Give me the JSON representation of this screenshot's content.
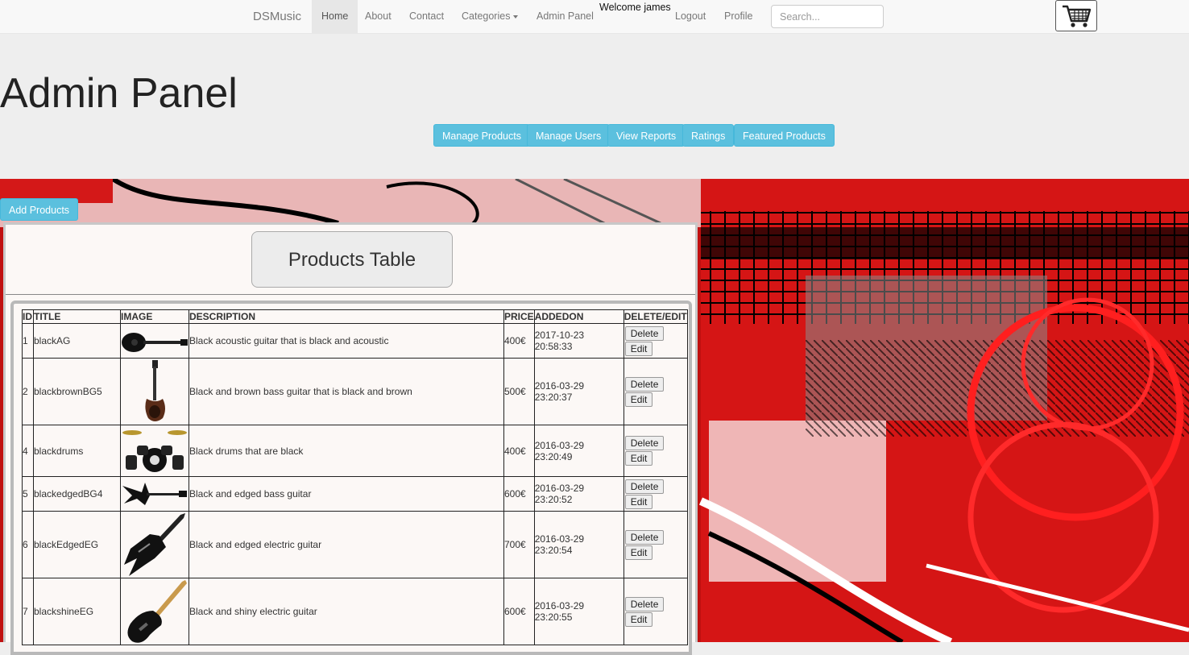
{
  "nav": {
    "brand": "DSMusic",
    "home": "Home",
    "about": "About",
    "contact": "Contact",
    "categories": "Categories",
    "admin_panel": "Admin Panel",
    "welcome": "Welcome james",
    "logout": "Logout",
    "profile": "Profile",
    "search_placeholder": "Search...",
    "cart_icon": "shopping-cart-icon"
  },
  "header": {
    "title": "Admin Panel",
    "buttons": [
      "Manage Products",
      "Manage Users",
      "View Reports",
      "Ratings",
      "Featured Products"
    ]
  },
  "add_button": "Add Products",
  "table": {
    "title": "Products Table",
    "columns": [
      "ID",
      "TITLE",
      "IMAGE",
      "DESCRIPTION",
      "PRICE",
      "ADDEDON",
      "DELETE/EDIT"
    ],
    "delete_label": "Delete",
    "edit_label": "Edit",
    "rows": [
      {
        "id": "1",
        "title": "blackAG",
        "image": "acoustic-guitar",
        "description": "Black acoustic guitar that is black and acoustic",
        "price": "400€",
        "added": "2017-10-23 20:58:33"
      },
      {
        "id": "2",
        "title": "blackbrownBG5",
        "image": "bass-guitar",
        "description": "Black and brown bass guitar that is black and brown",
        "price": "500€",
        "added": "2016-03-29 23:20:37"
      },
      {
        "id": "4",
        "title": "blackdrums",
        "image": "drum-kit",
        "description": "Black drums that are black",
        "price": "400€",
        "added": "2016-03-29 23:20:49"
      },
      {
        "id": "5",
        "title": "blackedgedBG4",
        "image": "edged-bass",
        "description": "Black and edged bass guitar",
        "price": "600€",
        "added": "2016-03-29 23:20:52"
      },
      {
        "id": "6",
        "title": "blackEdgedEG",
        "image": "edged-electric",
        "description": "Black and edged electric guitar",
        "price": "700€",
        "added": "2016-03-29 23:20:54"
      },
      {
        "id": "7",
        "title": "blackshineEG",
        "image": "electric-guitar",
        "description": "Black and shiny electric guitar",
        "price": "600€",
        "added": "2016-03-29 23:20:55"
      }
    ]
  }
}
